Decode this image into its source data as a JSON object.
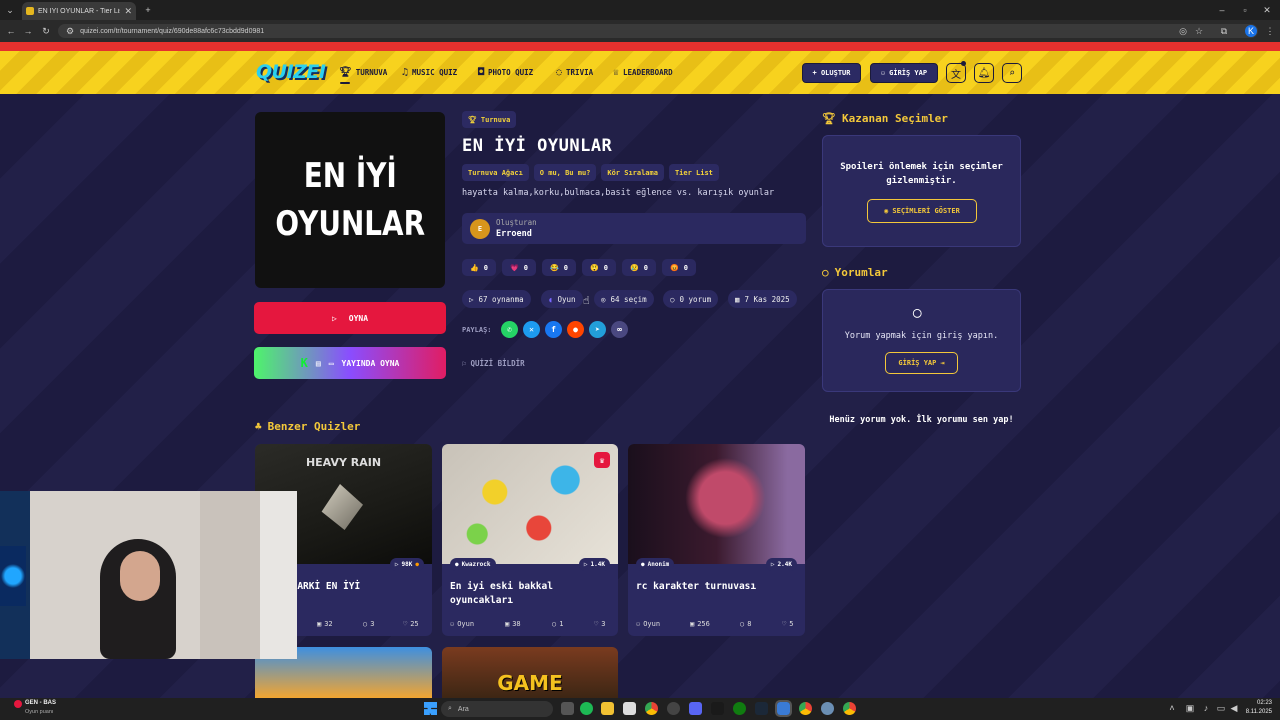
{
  "browser": {
    "tab_title": "EN İYİ OYUNLAR - Tier List | Kı",
    "url": "quizei.com/tr/tournament/quiz/690de88afc6c73cbdd9d0981",
    "profile_initial": "K"
  },
  "nav": {
    "logo": "QUIZEI",
    "items": [
      {
        "label": "TURNUVA",
        "icon": "trophy-icon"
      },
      {
        "label": "MUSIC QUIZ",
        "icon": "music-icon"
      },
      {
        "label": "PHOTO QUIZ",
        "icon": "camera-icon"
      },
      {
        "label": "TRIVIA",
        "icon": "chat-question-icon"
      },
      {
        "label": "LEADERBOARD",
        "icon": "leaderboard-icon"
      }
    ],
    "create_label": "+ OLUŞTUR",
    "login_label": "GİRİŞ YAP"
  },
  "quiz": {
    "thumbnail_text": "EN İYİ\nOYUNLAR",
    "category_tag": "Turnuva",
    "title": "EN İYİ OYUNLAR",
    "tags": [
      "Turnuva Ağacı",
      "O mu, Bu mu?",
      "Kör Sıralama",
      "Tier List"
    ],
    "description": "hayatta kalma,korku,bulmaca,basit eğlence vs. karışık oyunlar",
    "creator_label": "Oluşturan",
    "creator_name": "Erroend",
    "creator_initial": "E",
    "reactions": [
      {
        "emoji": "👍",
        "count": "0"
      },
      {
        "emoji": "💗",
        "count": "0"
      },
      {
        "emoji": "😂",
        "count": "0"
      },
      {
        "emoji": "😲",
        "count": "0"
      },
      {
        "emoji": "😢",
        "count": "0"
      },
      {
        "emoji": "😡",
        "count": "0"
      }
    ],
    "stats": {
      "plays": "67 oynanma",
      "category": "Oyun",
      "choices": "64 seçim",
      "comments": "0 yorum",
      "date": "7 Kas 2025"
    },
    "share_label": "PAYLAŞ:",
    "report_label": "QUİZİ BİLDİR",
    "play_label": "OYNA",
    "live_label": "YAYINDA OYNA"
  },
  "sidebar": {
    "winners_title": "Kazanan Seçimler",
    "spoiler_text": "Spoileri önlemek için seçimler gizlenmiştir.",
    "show_label": "SEÇİMLERİ GÖSTER",
    "comments_title": "Yorumlar",
    "login_prompt": "Yorum yapmak için giriş yapın.",
    "login_label": "GİRİŞ YAP",
    "no_comments": "Henüz yorum yok. İlk yorumu sen yap!"
  },
  "similar": {
    "title": "Benzer Quizler",
    "cards": [
      {
        "image_text": "HEAVY RAIN",
        "title": "YE KADARKİ EN İYİ",
        "author": "",
        "plays": "98K",
        "c1": "32",
        "c2": "3",
        "c3": "25"
      },
      {
        "image_text": "",
        "title": "En iyi eski bakkal oyuncakları",
        "author": "Kwazrock",
        "plays": "1.4K",
        "user": "Oyun",
        "c1": "38",
        "c2": "1",
        "c3": "3"
      },
      {
        "image_text": "",
        "title": "rc karakter turnuvası",
        "author": "Anonim",
        "plays": "2.4K",
        "user": "Oyun",
        "c1": "256",
        "c2": "8",
        "c3": "5"
      }
    ],
    "bottom_card_text": "GAME"
  },
  "taskbar": {
    "search_placeholder": "Ara",
    "left_title": "GEN - BAS",
    "left_sub": "Oyun puanı",
    "time": "02:23",
    "date": "8.11.2025"
  },
  "colors": {
    "accent_yellow": "#f3c83a",
    "play_red": "#e5173e",
    "page_bg": "#1c1a3f"
  }
}
